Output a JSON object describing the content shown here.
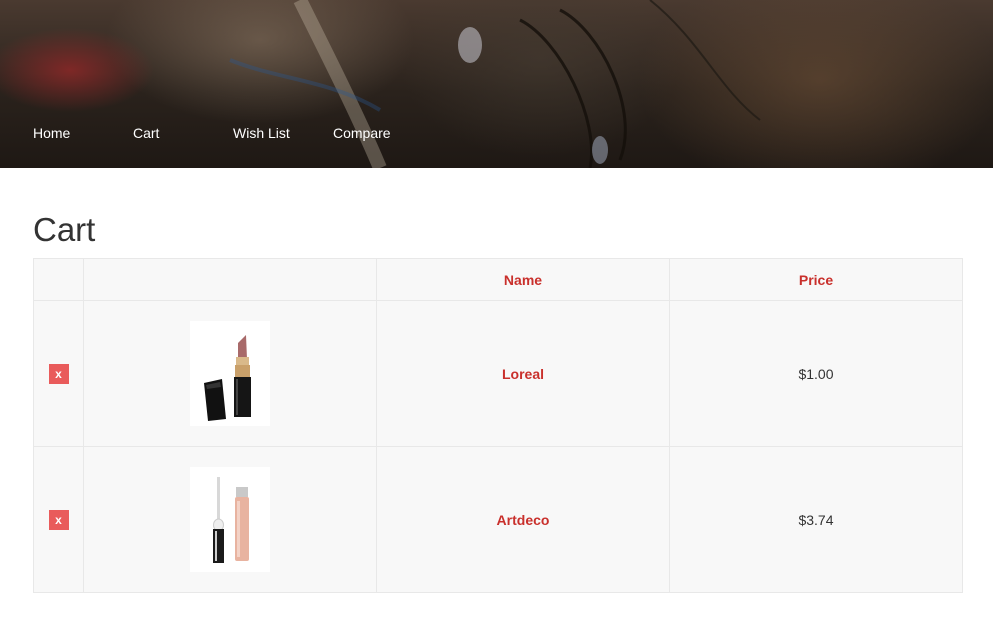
{
  "nav": {
    "items": [
      {
        "label": "Home"
      },
      {
        "label": "Cart"
      },
      {
        "label": "Wish List"
      },
      {
        "label": "Compare"
      }
    ]
  },
  "page": {
    "title": "Cart"
  },
  "table": {
    "headers": [
      "",
      "",
      "Name",
      "Price"
    ],
    "rows": [
      {
        "remove_label": "x",
        "name": "Loreal",
        "price": "$1.00",
        "thumb_icon": "lipstick-icon"
      },
      {
        "remove_label": "x",
        "name": "Artdeco",
        "price": "$3.74",
        "thumb_icon": "lip-gloss-icon"
      }
    ]
  },
  "colors": {
    "accent": "#c9302c",
    "remove": "#e95b5b",
    "table_bg": "#f8f8f8",
    "border": "#e8e8e8"
  }
}
